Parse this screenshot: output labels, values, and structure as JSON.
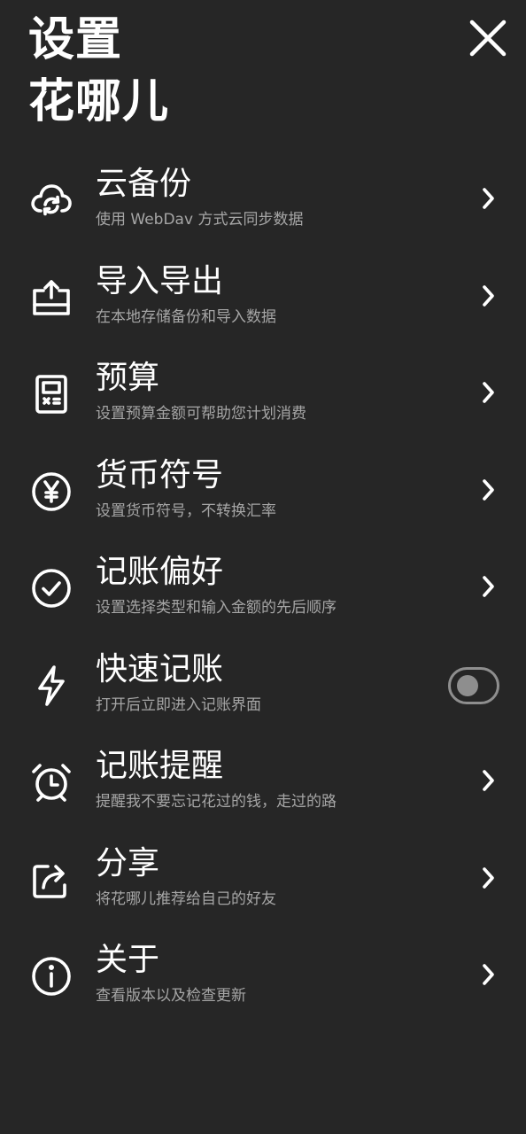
{
  "header": {
    "title_line1": "设置",
    "title_line2": "花哪儿"
  },
  "colors": {
    "background": "#262626",
    "text_primary": "#ffffff",
    "text_secondary": "#a6a6a6",
    "toggle_off": "#8e8e8e"
  },
  "items": [
    {
      "key": "cloud-backup",
      "icon": "cloud-sync-icon",
      "label": "云备份",
      "desc": "使用 WebDav 方式云同步数据",
      "control": "chevron"
    },
    {
      "key": "import-export",
      "icon": "tray-upload-icon",
      "label": "导入导出",
      "desc": "在本地存储备份和导入数据",
      "control": "chevron"
    },
    {
      "key": "budget",
      "icon": "calculator-icon",
      "label": "预算",
      "desc": "设置预算金额可帮助您计划消费",
      "control": "chevron"
    },
    {
      "key": "currency-symbol",
      "icon": "yen-icon",
      "label": "货币符号",
      "desc": "设置货币符号，不转换汇率",
      "control": "chevron"
    },
    {
      "key": "bookkeeping-preference",
      "icon": "check-circle-icon",
      "label": "记账偏好",
      "desc": "设置选择类型和输入金额的先后顺序",
      "control": "chevron"
    },
    {
      "key": "quick-bookkeeping",
      "icon": "lightning-icon",
      "label": "快速记账",
      "desc": "打开后立即进入记账界面",
      "control": "toggle",
      "toggle_on": false
    },
    {
      "key": "bookkeeping-reminder",
      "icon": "alarm-clock-icon",
      "label": "记账提醒",
      "desc": "提醒我不要忘记花过的钱，走过的路",
      "control": "chevron"
    },
    {
      "key": "share",
      "icon": "share-icon",
      "label": "分享",
      "desc": "将花哪儿推荐给自己的好友",
      "control": "chevron"
    },
    {
      "key": "about",
      "icon": "info-icon",
      "label": "关于",
      "desc": "查看版本以及检查更新",
      "control": "chevron"
    }
  ]
}
